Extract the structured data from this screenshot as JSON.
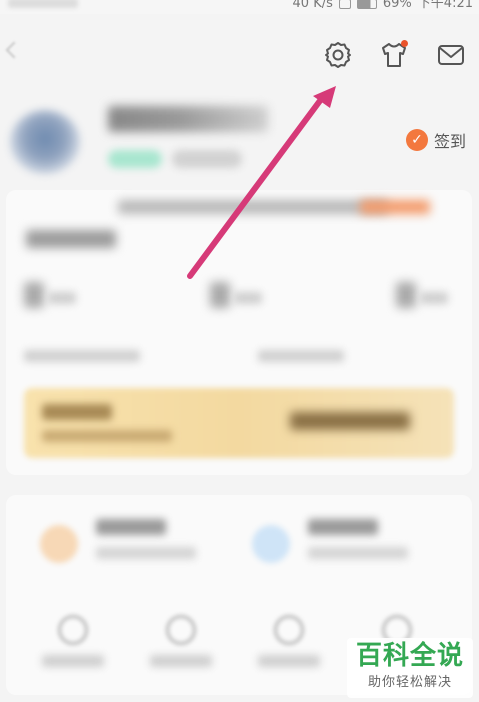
{
  "status_bar": {
    "speed": "40 K/s",
    "battery": "69%",
    "time": "下午4:21"
  },
  "top_icons": [
    "settings-icon",
    "shirt-icon",
    "mail-icon"
  ],
  "signin": {
    "label": "签到",
    "icon": "check-icon"
  },
  "colors": {
    "accent_orange": "#f3783e",
    "arrow": "#d63a78",
    "watermark_green": "#34a853",
    "vip_gold": "#f3d9a0"
  },
  "watermark": {
    "title": "百科全说",
    "subtitle": "助你轻松解决"
  }
}
